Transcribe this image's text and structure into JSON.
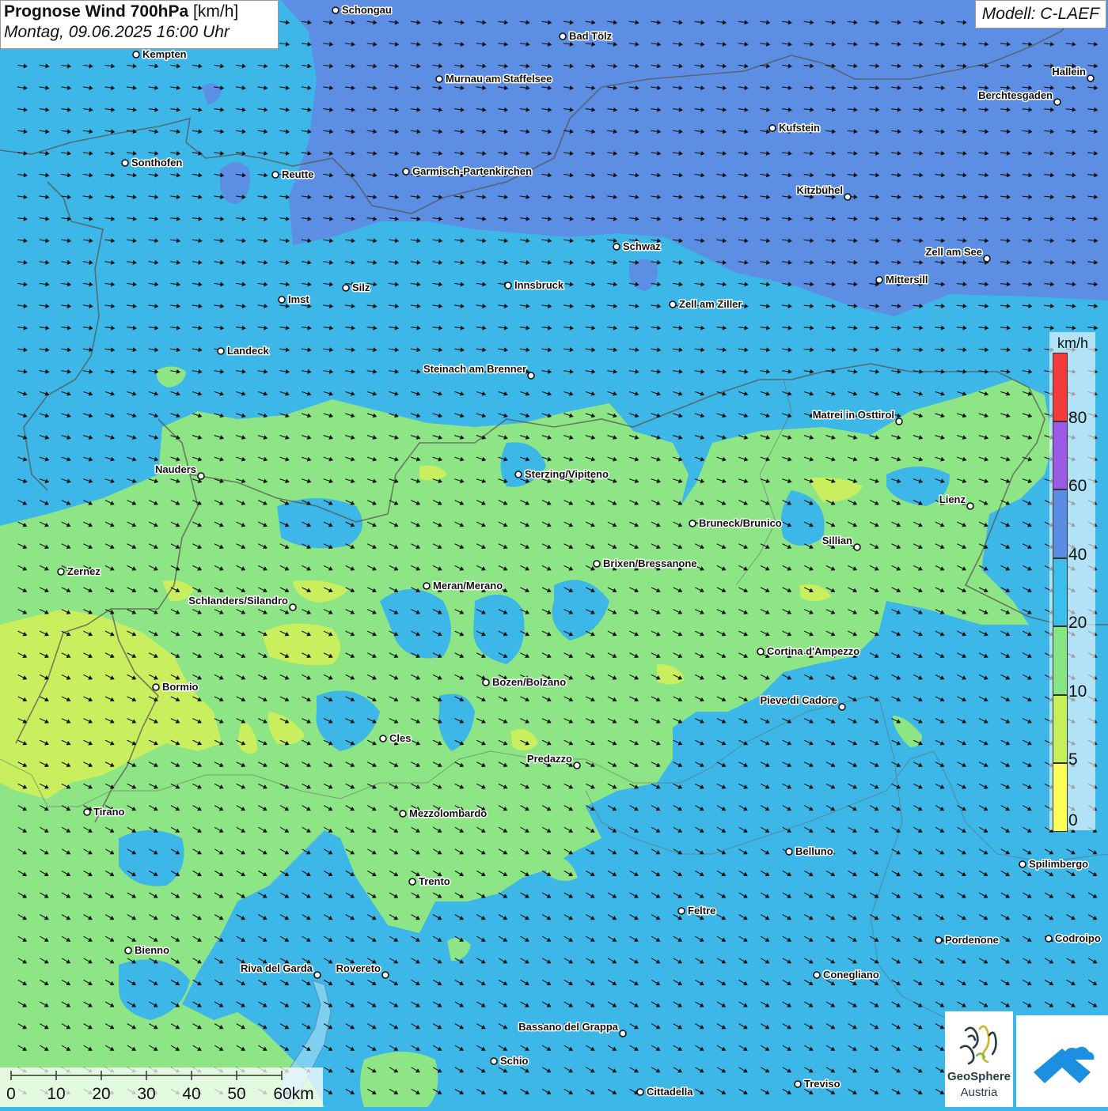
{
  "header": {
    "title_bold": "Prognose Wind 700hPa",
    "title_unit": "[km/h]",
    "datetime": "Montag, 09.06.2025 16:00 Uhr",
    "model": "Modell: C-LAEF"
  },
  "legend": {
    "unit": "km/h",
    "labels": [
      "0",
      "5",
      "10",
      "20",
      "40",
      "60",
      "80"
    ],
    "colors": [
      "#ffff5a",
      "#c6f05a",
      "#86e683",
      "#38bfea",
      "#5b8ce6",
      "#9a5ae6",
      "#f23b3b"
    ]
  },
  "scale": {
    "labels": [
      "0",
      "10",
      "20",
      "30",
      "40",
      "50",
      "60km"
    ]
  },
  "logo": {
    "name_line1": "GeoSphere",
    "name_line2": "Austria"
  },
  "places": [
    {
      "name": "Schongau",
      "side": "right"
    },
    {
      "name": "Bad Tölz",
      "side": "right"
    },
    {
      "name": "Kempten",
      "side": "right"
    },
    {
      "name": "Murnau am Staffelsee",
      "side": "right"
    },
    {
      "name": "Hallein",
      "side": "left"
    },
    {
      "name": "Berchtesgaden",
      "side": "left"
    },
    {
      "name": "Kufstein",
      "side": "right"
    },
    {
      "name": "Sonthofen",
      "side": "right"
    },
    {
      "name": "Reutte",
      "side": "right"
    },
    {
      "name": "Garmisch-Partenkirchen",
      "side": "right"
    },
    {
      "name": "Kitzbühel",
      "side": "left"
    },
    {
      "name": "Schwaz",
      "side": "right"
    },
    {
      "name": "Zell am See",
      "side": "left"
    },
    {
      "name": "Mittersill",
      "side": "right"
    },
    {
      "name": "Innsbruck",
      "side": "right"
    },
    {
      "name": "Silz",
      "side": "right"
    },
    {
      "name": "Imst",
      "side": "right"
    },
    {
      "name": "Zell am Ziller",
      "side": "right"
    },
    {
      "name": "Landeck",
      "side": "right"
    },
    {
      "name": "Steinach am Brenner",
      "side": "left"
    },
    {
      "name": "Matrei in Osttirol",
      "side": "left"
    },
    {
      "name": "Nauders",
      "side": "left"
    },
    {
      "name": "Sterzing/Vipiteno",
      "side": "right"
    },
    {
      "name": "Lienz",
      "side": "left"
    },
    {
      "name": "Bruneck/Brunico",
      "side": "right"
    },
    {
      "name": "Sillian",
      "side": "left"
    },
    {
      "name": "Brixen/Bressanone",
      "side": "right"
    },
    {
      "name": "Zernez",
      "side": "right"
    },
    {
      "name": "Meran/Merano",
      "side": "right"
    },
    {
      "name": "Schlanders/Silandro",
      "side": "left"
    },
    {
      "name": "Cortina d'Ampezzo",
      "side": "right"
    },
    {
      "name": "Bozen/Bolzano",
      "side": "right"
    },
    {
      "name": "Bormio",
      "side": "right"
    },
    {
      "name": "Pieve di Cadore",
      "side": "left"
    },
    {
      "name": "Cles",
      "side": "right"
    },
    {
      "name": "Predazzo",
      "side": "left"
    },
    {
      "name": "Tirano",
      "side": "right"
    },
    {
      "name": "Mezzolombardo",
      "side": "right"
    },
    {
      "name": "Belluno",
      "side": "right"
    },
    {
      "name": "Spilimbergo",
      "side": "right"
    },
    {
      "name": "Trento",
      "side": "right"
    },
    {
      "name": "Feltre",
      "side": "right"
    },
    {
      "name": "Pordenone",
      "side": "right"
    },
    {
      "name": "Codroipo",
      "side": "right"
    },
    {
      "name": "Bienno",
      "side": "right"
    },
    {
      "name": "Riva del Garda",
      "side": "left"
    },
    {
      "name": "Rovereto",
      "side": "left"
    },
    {
      "name": "Conegliano",
      "side": "right"
    },
    {
      "name": "Bassano del Grappa",
      "side": "left"
    },
    {
      "name": "Schio",
      "side": "right"
    },
    {
      "name": "Treviso",
      "side": "right"
    },
    {
      "name": "Cittadella",
      "side": "right"
    }
  ]
}
